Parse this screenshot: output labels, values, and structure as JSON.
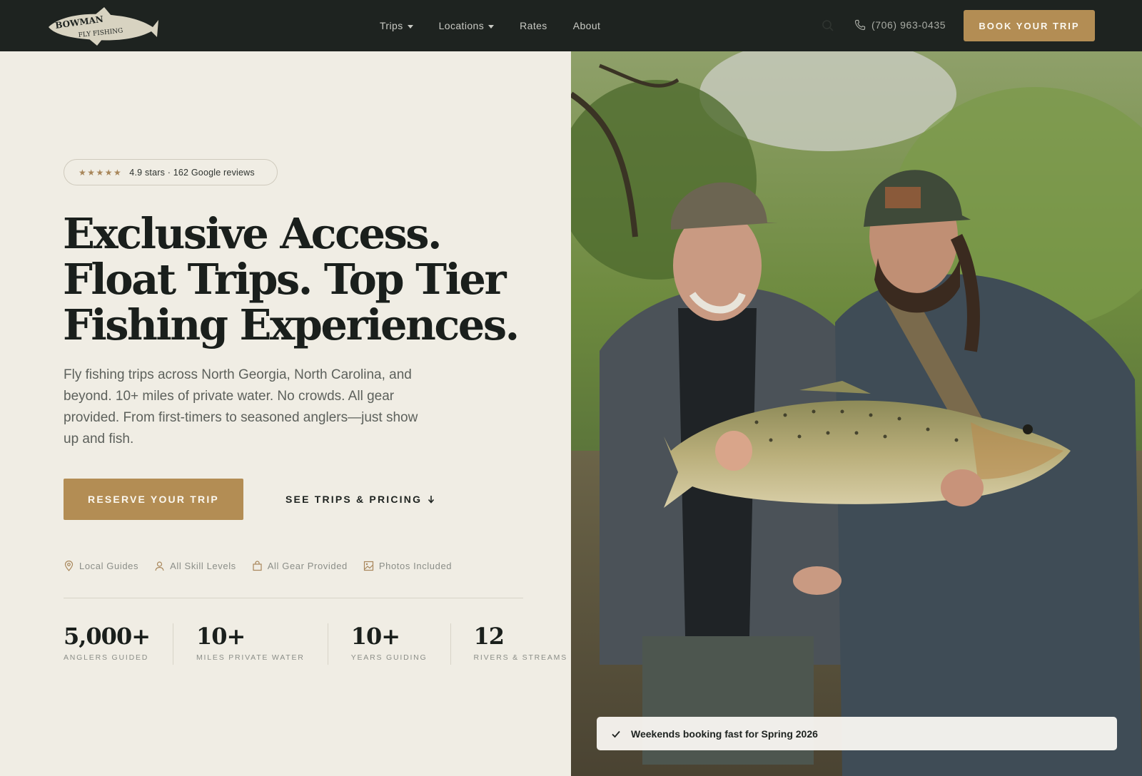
{
  "header": {
    "logo_text_top": "BOWMAN",
    "logo_text_bottom": "FLY FISHING",
    "nav": [
      {
        "label": "Trips",
        "has_dropdown": true
      },
      {
        "label": "Locations",
        "has_dropdown": true
      },
      {
        "label": "Rates",
        "has_dropdown": false
      },
      {
        "label": "About",
        "has_dropdown": false
      }
    ],
    "phone": "(706) 963-0435",
    "book_button": "BOOK YOUR TRIP"
  },
  "hero": {
    "rating_stars": "★★★★★",
    "rating_text": "4.9 stars · 162 Google reviews",
    "headline": "Exclusive Access. Float Trips. Top Tier Fishing Experiences.",
    "subtext": "Fly fishing trips across North Georgia, North Carolina, and beyond. 10+ miles of private water. No crowds. All gear provided. From first-timers to seasoned anglers—just show up and fish.",
    "primary_button": "RESERVE YOUR TRIP",
    "secondary_button": "SEE TRIPS & PRICING",
    "features": [
      {
        "icon": "map-pin-icon",
        "label": "Local Guides"
      },
      {
        "icon": "user-icon",
        "label": "All Skill Levels"
      },
      {
        "icon": "bag-icon",
        "label": "All Gear Provided"
      },
      {
        "icon": "image-icon",
        "label": "Photos Included"
      }
    ],
    "stats": [
      {
        "value": "5,000+",
        "label": "ANGLERS GUIDED"
      },
      {
        "value": "10+",
        "label": "MILES PRIVATE WATER"
      },
      {
        "value": "10+",
        "label": "YEARS GUIDING"
      },
      {
        "value": "12",
        "label": "RIVERS & STREAMS"
      }
    ]
  },
  "photo": {
    "description_icon": "photo-anglers-with-trout",
    "toast": "Weekends booking fast for Spring 2026"
  },
  "colors": {
    "header_bg": "#1e2320",
    "accent": "#b38d54",
    "page_bg": "#f0ede4"
  }
}
